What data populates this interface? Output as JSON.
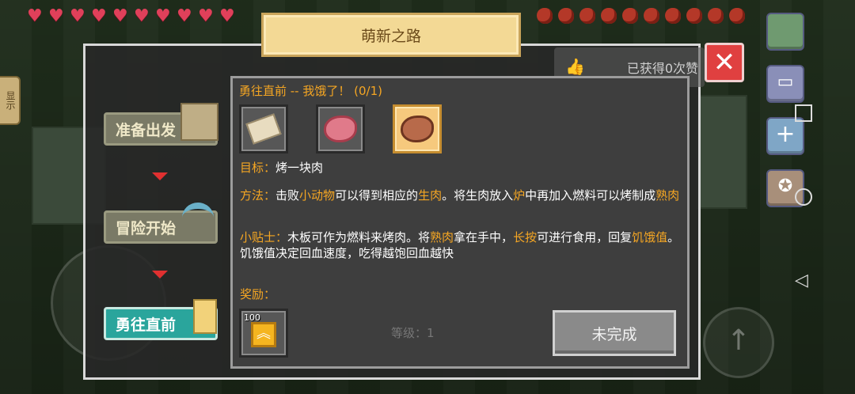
{
  "window": {
    "title": "萌新之路"
  },
  "hud": {
    "hearts": 10,
    "food": 10
  },
  "header": {
    "likes_text": "已获得0次赞"
  },
  "left_tab": {
    "label": "显示"
  },
  "steps": [
    {
      "label": "准备出发",
      "state": "done"
    },
    {
      "label": "冒险开始",
      "state": "done"
    },
    {
      "label": "勇往直前",
      "state": "active"
    }
  ],
  "quest": {
    "title": "勇往直前 -- 我饿了！ (0/1)",
    "items": [
      {
        "icon": "scroll-icon",
        "selected": false
      },
      {
        "icon": "raw-meat-icon",
        "selected": false
      },
      {
        "icon": "cooked-meat-icon",
        "selected": true
      }
    ],
    "goal_label": "目标：",
    "goal_text": "烤一块肉",
    "method_label": "方法：",
    "method_parts": [
      "击败",
      "小动物",
      "可以得到相应的",
      "生肉",
      "。将生肉放入",
      "炉",
      "中再加入燃料可以烤制成",
      "熟肉"
    ],
    "tip_label": "小贴士：",
    "tip_parts": [
      "木板可作为燃料来烤肉。将",
      "熟肉",
      "拿在手中，",
      "长按",
      "可进行食用，回复",
      "饥饿值",
      "。饥饿值决定回血速度，吃得越饱回血越快"
    ],
    "reward_label": "奖励：",
    "reward_amount": "100",
    "status_button": "未完成",
    "background_level": "等级：1"
  },
  "colors": {
    "accent": "#f5a623",
    "active_step": "#2aa59c",
    "close": "#e04040"
  }
}
